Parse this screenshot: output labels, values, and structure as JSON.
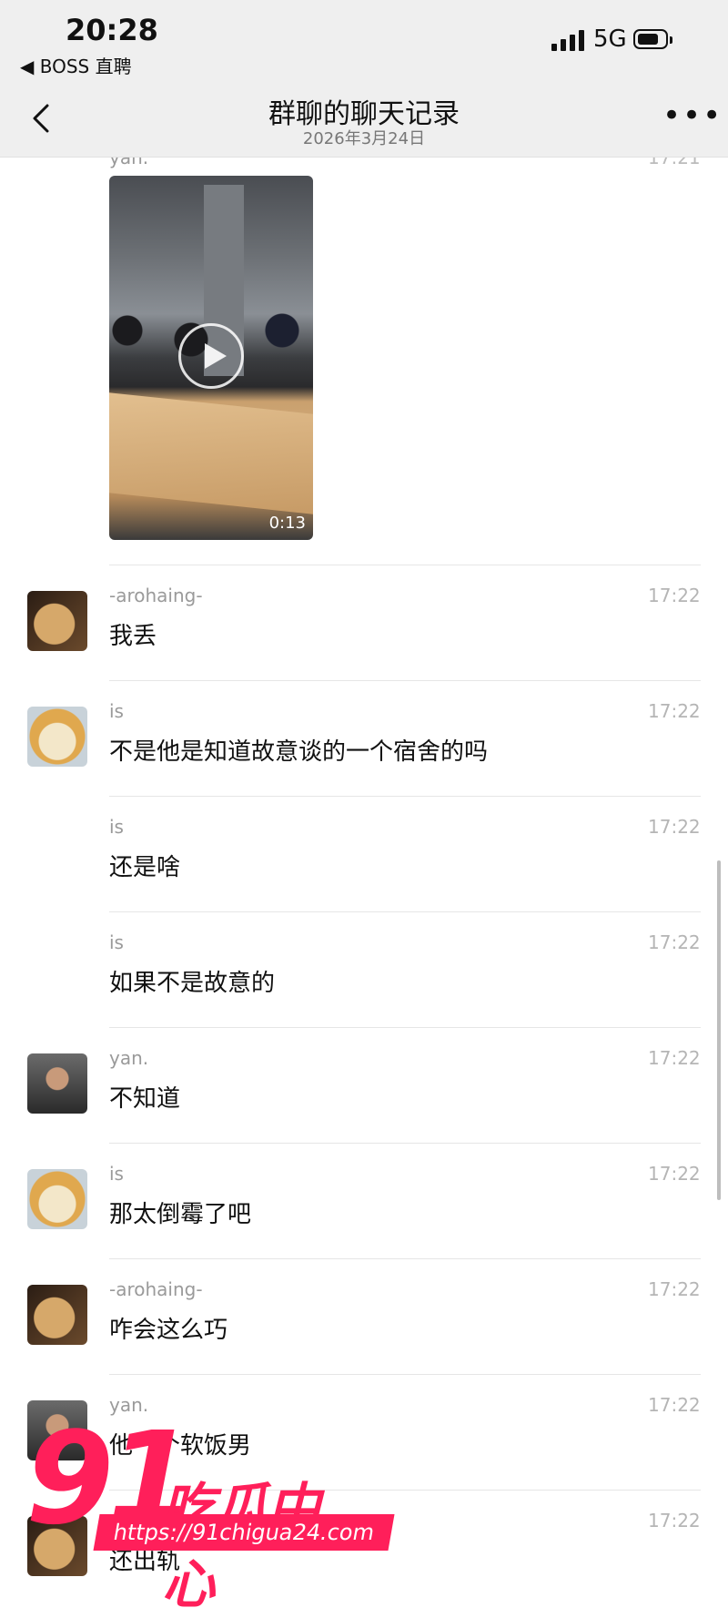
{
  "status_bar": {
    "time": "20:28",
    "back_app": "◀ BOSS 直聘",
    "network": "5G"
  },
  "header": {
    "title": "群聊的聊天记录",
    "subtitle": "2026年3月24日",
    "back_icon": "chevron-left-icon",
    "more_icon": "more-dots-icon"
  },
  "top_partial": {
    "sender": "yan.",
    "time": "17:21",
    "video_duration": "0:13"
  },
  "messages": [
    {
      "sender": "-arohaing-",
      "time": "17:22",
      "text": "我丢",
      "avatar": "cat-avatar"
    },
    {
      "sender": "is",
      "time": "17:22",
      "text": "不是他是知道故意谈的一个宿舍的吗",
      "avatar": "kitten-avatar"
    },
    {
      "sender": "is",
      "time": "17:22",
      "text": "还是啥",
      "avatar": ""
    },
    {
      "sender": "is",
      "time": "17:22",
      "text": "如果不是故意的",
      "avatar": ""
    },
    {
      "sender": "yan.",
      "time": "17:22",
      "text": "不知道",
      "avatar": "person-avatar"
    },
    {
      "sender": "is",
      "time": "17:22",
      "text": "那太倒霉了吧",
      "avatar": "kitten-avatar"
    },
    {
      "sender": "-arohaing-",
      "time": "17:22",
      "text": "咋会这么巧",
      "avatar": "cat-avatar"
    },
    {
      "sender": "yan.",
      "time": "17:22",
      "text": "他一个软饭男",
      "avatar": "person-avatar"
    },
    {
      "sender": "",
      "time": "17:22",
      "text": "还出轨",
      "avatar": "cat-avatar"
    }
  ],
  "watermark": {
    "number": "91",
    "name": "吃瓜中心",
    "url": "https://91chigua24.com"
  }
}
